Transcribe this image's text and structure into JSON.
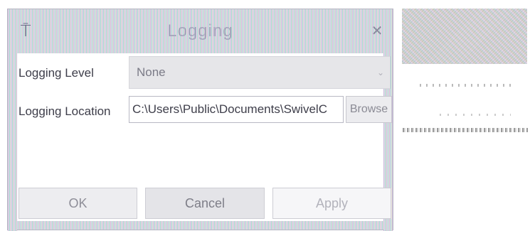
{
  "window": {
    "title": "Logging",
    "icon": "app-icon",
    "close_glyph": "✕"
  },
  "form": {
    "logging_level": {
      "label": "Logging Level",
      "value": "None",
      "chevron": "⌄"
    },
    "logging_location": {
      "label": "Logging Location",
      "value": "C:\\Users\\Public\\Documents\\SwivelC",
      "browse_label": "Browse"
    }
  },
  "buttons": {
    "ok": "OK",
    "cancel": "Cancel",
    "apply": "Apply"
  }
}
